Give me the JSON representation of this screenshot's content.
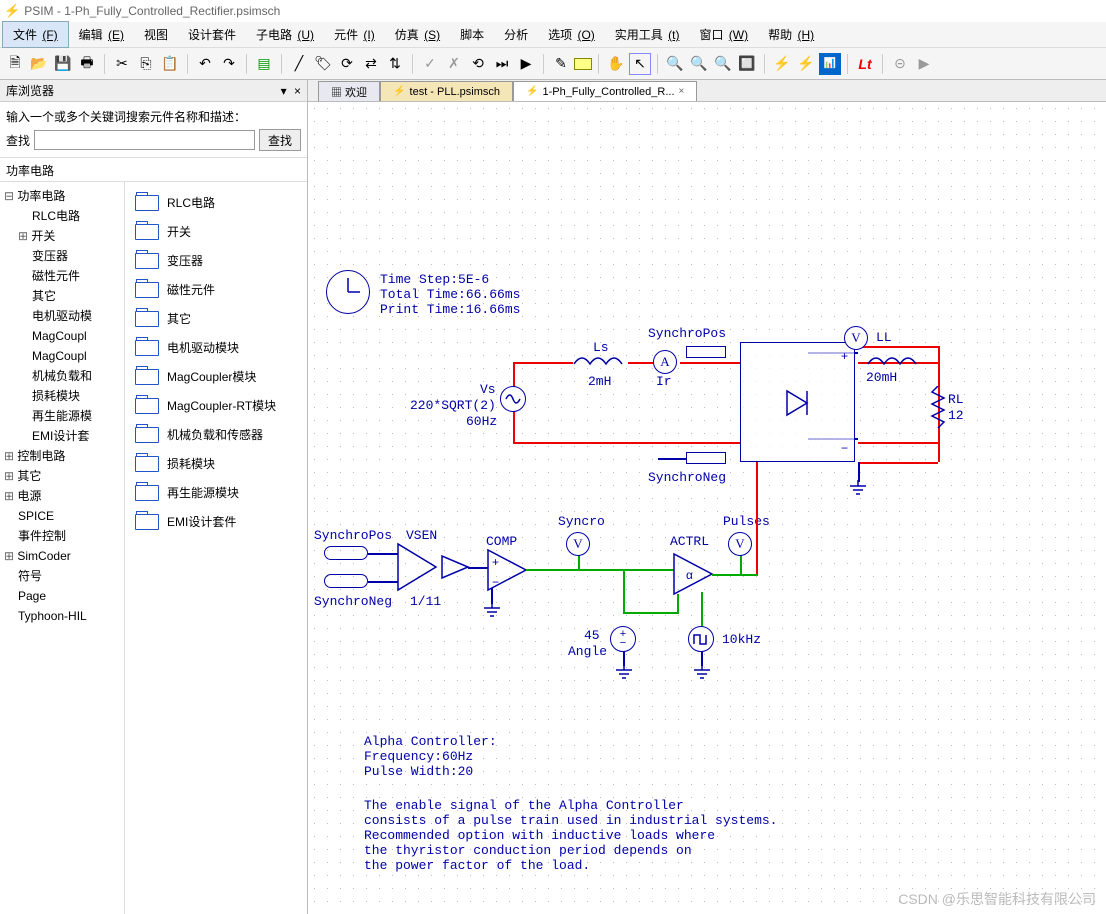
{
  "title_bar": {
    "app": "PSIM",
    "separator": "-",
    "file": "1-Ph_Fully_Controlled_Rectifier.psimsch"
  },
  "menu": [
    {
      "label": "文件",
      "key": "(F)"
    },
    {
      "label": "编辑",
      "key": "(E)"
    },
    {
      "label": "视图",
      "key": ""
    },
    {
      "label": "设计套件",
      "key": ""
    },
    {
      "label": "子电路",
      "key": "(U)"
    },
    {
      "label": "元件",
      "key": "(I)"
    },
    {
      "label": "仿真",
      "key": "(S)"
    },
    {
      "label": "脚本",
      "key": ""
    },
    {
      "label": "分析",
      "key": ""
    },
    {
      "label": "选项",
      "key": "(O)"
    },
    {
      "label": "实用工具",
      "key": "(t)"
    },
    {
      "label": "窗口",
      "key": "(W)"
    },
    {
      "label": "帮助",
      "key": "(H)"
    }
  ],
  "sidebar": {
    "title": "库浏览器",
    "search_hint": "输入一个或多个关键词搜索元件名称和描述：",
    "search_label": "查找",
    "search_btn": "查找",
    "breadcrumb": "功率电路",
    "tree": [
      {
        "label": "功率电路",
        "cls": "lvl0nop"
      },
      {
        "label": "RLC电路",
        "cls": "lvl2"
      },
      {
        "label": "开关",
        "cls": "lvl1 lvl0"
      },
      {
        "label": "变压器",
        "cls": "lvl2"
      },
      {
        "label": "磁性元件",
        "cls": "lvl2"
      },
      {
        "label": "其它",
        "cls": "lvl2"
      },
      {
        "label": "电机驱动模",
        "cls": "lvl2"
      },
      {
        "label": "MagCoupl",
        "cls": "lvl2"
      },
      {
        "label": "MagCoupl",
        "cls": "lvl2"
      },
      {
        "label": "机械负载和",
        "cls": "lvl2"
      },
      {
        "label": "损耗模块",
        "cls": "lvl2"
      },
      {
        "label": "再生能源模",
        "cls": "lvl2"
      },
      {
        "label": "EMI设计套",
        "cls": "lvl2"
      },
      {
        "label": "控制电路",
        "cls": "lvl0"
      },
      {
        "label": "其它",
        "cls": "lvl0"
      },
      {
        "label": "电源",
        "cls": "lvl0"
      },
      {
        "label": "SPICE",
        "cls": "lvl1"
      },
      {
        "label": "事件控制",
        "cls": "lvl1"
      },
      {
        "label": "SimCoder",
        "cls": "lvl0"
      },
      {
        "label": "符号",
        "cls": "lvl1"
      },
      {
        "label": "Page",
        "cls": "lvl1"
      },
      {
        "label": "Typhoon-HIL",
        "cls": "lvl1"
      }
    ],
    "folders": [
      "RLC电路",
      "开关",
      "变压器",
      "磁性元件",
      "其它",
      "电机驱动模块",
      "MagCoupler模块",
      "MagCoupler-RT模块",
      "机械负载和传感器",
      "损耗模块",
      "再生能源模块",
      "EMI设计套件"
    ]
  },
  "tabs": [
    {
      "label": "欢迎",
      "type": "welcome"
    },
    {
      "label": "test - PLL.psimsch",
      "type": "file"
    },
    {
      "label": "1-Ph_Fully_Controlled_R...",
      "type": "file",
      "active": true
    }
  ],
  "schematic": {
    "sim_info": "Time Step:5E-6\nTotal Time:66.66ms\nPrint Time:16.66ms",
    "labels": {
      "SynchroPos1": "SynchroPos",
      "SynchroNeg1": "SynchroNeg",
      "Ls": "Ls",
      "Ls_val": "2mH",
      "Ir": "Ir",
      "A": "A",
      "Vs": "Vs",
      "Vs_val": "220*SQRT(2)",
      "Vs_freq": "60Hz",
      "V": "V",
      "LL": "LL",
      "LL_val": "20mH",
      "RL": "RL",
      "RL_val": "12",
      "SynchroPos2": "SynchroPos",
      "SynchroNeg2": "SynchroNeg",
      "VSEN": "VSEN",
      "divider": "1/11",
      "COMP": "COMP",
      "Syncro": "Syncro",
      "ACTRL": "ACTRL",
      "Pulses": "Pulses",
      "angle45": "45",
      "angle": "Angle",
      "freq10k": "10kHz",
      "note_title": "Alpha Controller:\nFrequency:60Hz\nPulse Width:20",
      "note_body": "The enable signal of the Alpha Controller\nconsists of a pulse train used in industrial systems.\nRecommended option with inductive loads where\nthe thyristor conduction period depends on\nthe power factor of the load."
    }
  },
  "toolbar_lt": "Lt",
  "watermark": "CSDN @乐思智能科技有限公司"
}
